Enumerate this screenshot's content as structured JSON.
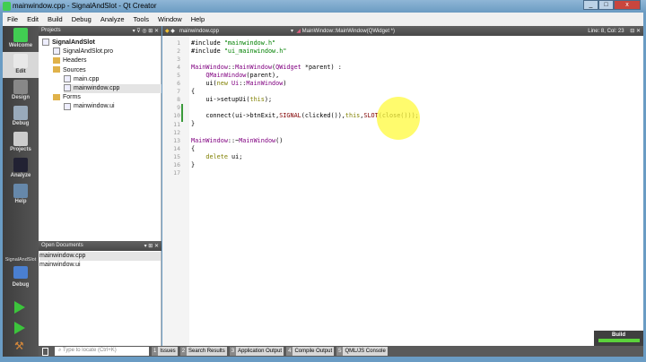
{
  "window": {
    "title": "mainwindow.cpp - SignalAndSlot - Qt Creator",
    "min": "_",
    "max": "□",
    "close": "x"
  },
  "menu": [
    "File",
    "Edit",
    "Build",
    "Debug",
    "Analyze",
    "Tools",
    "Window",
    "Help"
  ],
  "modes": [
    "Welcome",
    "Edit",
    "Design",
    "Debug",
    "Projects",
    "Analyze",
    "Help"
  ],
  "kit": {
    "project": "SignalAndSlot",
    "mode": "Debug"
  },
  "projects": {
    "header": "Projects",
    "items": [
      {
        "label": "SignalAndSlot",
        "bold": true,
        "indent": 0,
        "type": "proj"
      },
      {
        "label": "SignalAndSlot.pro",
        "indent": 1,
        "type": "file"
      },
      {
        "label": "Headers",
        "indent": 1,
        "type": "folder"
      },
      {
        "label": "Sources",
        "indent": 1,
        "type": "folder"
      },
      {
        "label": "main.cpp",
        "indent": 2,
        "type": "file"
      },
      {
        "label": "mainwindow.cpp",
        "indent": 2,
        "type": "file",
        "selected": true
      },
      {
        "label": "Forms",
        "indent": 1,
        "type": "folder"
      },
      {
        "label": "mainwindow.ui",
        "indent": 2,
        "type": "file"
      }
    ]
  },
  "open_documents": {
    "header": "Open Documents",
    "items": [
      "mainwindow.cpp",
      "mainwindow.ui"
    ]
  },
  "editor": {
    "file": "mainwindow.cpp",
    "symbol": "MainWindow::MainWindow(QWidget *)",
    "position": "Line: 8, Col: 23",
    "lines": [
      [
        [
          "#include ",
          "p"
        ],
        [
          "\"mainwindow.h\"",
          "s"
        ]
      ],
      [
        [
          "#include ",
          "p"
        ],
        [
          "\"ui_mainwindow.h\"",
          "s"
        ]
      ],
      [],
      [
        [
          "MainWindow",
          "c"
        ],
        [
          "::",
          "p"
        ],
        [
          "MainWindow",
          "c"
        ],
        [
          "(",
          "p"
        ],
        [
          "QWidget",
          "c"
        ],
        [
          " *parent) :",
          "p"
        ]
      ],
      [
        [
          "    ",
          "p"
        ],
        [
          "QMainWindow",
          "c"
        ],
        [
          "(parent),",
          "p"
        ]
      ],
      [
        [
          "    ui(",
          "p"
        ],
        [
          "new",
          "k"
        ],
        [
          " ",
          "p"
        ],
        [
          "Ui",
          "c"
        ],
        [
          "::",
          "p"
        ],
        [
          "MainWindow",
          "c"
        ],
        [
          ")",
          "p"
        ]
      ],
      [
        [
          "{",
          "p"
        ]
      ],
      [
        [
          "    ui->setupUi(",
          "p"
        ],
        [
          "this",
          "k"
        ],
        [
          ");",
          "p"
        ]
      ],
      [],
      [
        [
          "    connect(ui->btnExit,",
          "p"
        ],
        [
          "SIGNAL",
          "m"
        ],
        [
          "(clicked()),",
          "p"
        ],
        [
          "this",
          "k"
        ],
        [
          ",",
          "p"
        ],
        [
          "SLOT",
          "m"
        ],
        [
          "(close()));",
          "p"
        ]
      ],
      [
        [
          "}",
          "p"
        ]
      ],
      [],
      [
        [
          "MainWindow",
          "c"
        ],
        [
          "::~",
          "p"
        ],
        [
          "MainWindow",
          "c"
        ],
        [
          "()",
          "p"
        ]
      ],
      [
        [
          "{",
          "p"
        ]
      ],
      [
        [
          "    ",
          "p"
        ],
        [
          "delete",
          "k"
        ],
        [
          " ui;",
          "p"
        ]
      ],
      [
        [
          "}",
          "p"
        ]
      ],
      []
    ]
  },
  "locator": {
    "placeholder": "Type to locate (Ctrl+K)"
  },
  "output_tabs": [
    {
      "n": "1",
      "label": "Issues"
    },
    {
      "n": "2",
      "label": "Search Results"
    },
    {
      "n": "3",
      "label": "Application Output"
    },
    {
      "n": "4",
      "label": "Compile Output"
    },
    {
      "n": "5",
      "label": "QML/JS Console"
    }
  ],
  "build": {
    "label": "Build",
    "progress": 1.0
  }
}
